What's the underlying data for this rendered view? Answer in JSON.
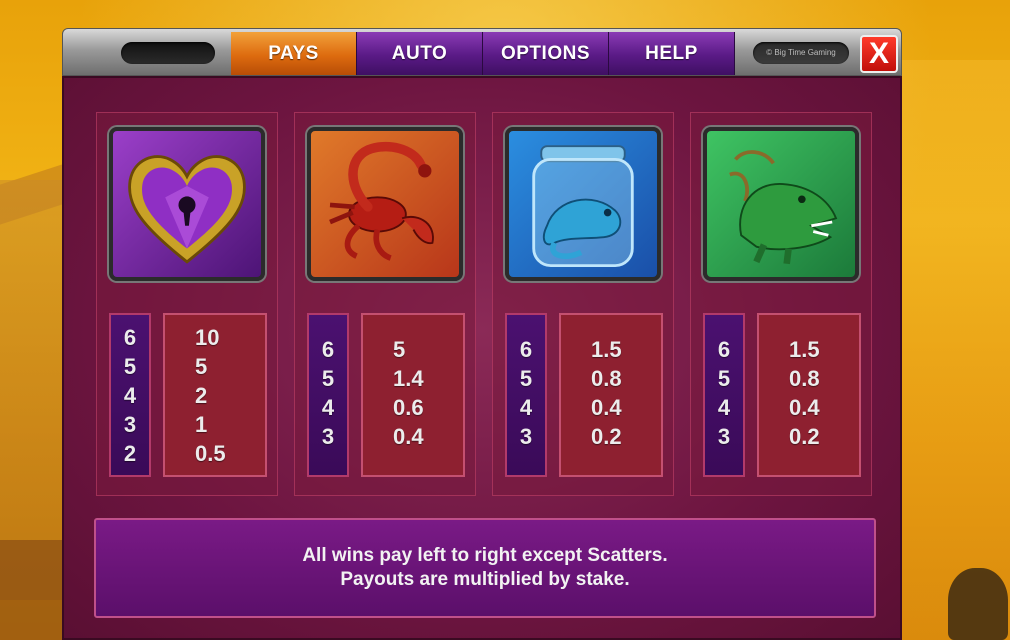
{
  "tabs": [
    {
      "label": "PAYS",
      "active": true
    },
    {
      "label": "AUTO",
      "active": false
    },
    {
      "label": "OPTIONS",
      "active": false
    },
    {
      "label": "HELP",
      "active": false
    }
  ],
  "brand": "© Big Time Gaming",
  "close_label": "X",
  "colors": {
    "active_tab": "#dd6b0f",
    "tab": "#5a1a86",
    "panel": "#6d1540",
    "close": "#d1150e"
  },
  "symbols": [
    {
      "icon": "purple-heart-lock-icon",
      "counts": [
        "6",
        "5",
        "4",
        "3",
        "2"
      ],
      "pays": [
        "10",
        "5",
        "2",
        "1",
        "0.5"
      ]
    },
    {
      "icon": "red-scorpion-icon",
      "counts": [
        "6",
        "5",
        "4",
        "3"
      ],
      "pays": [
        "5",
        "1.4",
        "0.6",
        "0.4"
      ]
    },
    {
      "icon": "blue-lizard-jar-icon",
      "counts": [
        "6",
        "5",
        "4",
        "3"
      ],
      "pays": [
        "1.5",
        "0.8",
        "0.4",
        "0.2"
      ]
    },
    {
      "icon": "green-crocodile-icon",
      "counts": [
        "6",
        "5",
        "4",
        "3"
      ],
      "pays": [
        "1.5",
        "0.8",
        "0.4",
        "0.2"
      ]
    }
  ],
  "info": {
    "line1": "All wins pay left to right except Scatters.",
    "line2": "Payouts are multiplied by stake."
  }
}
